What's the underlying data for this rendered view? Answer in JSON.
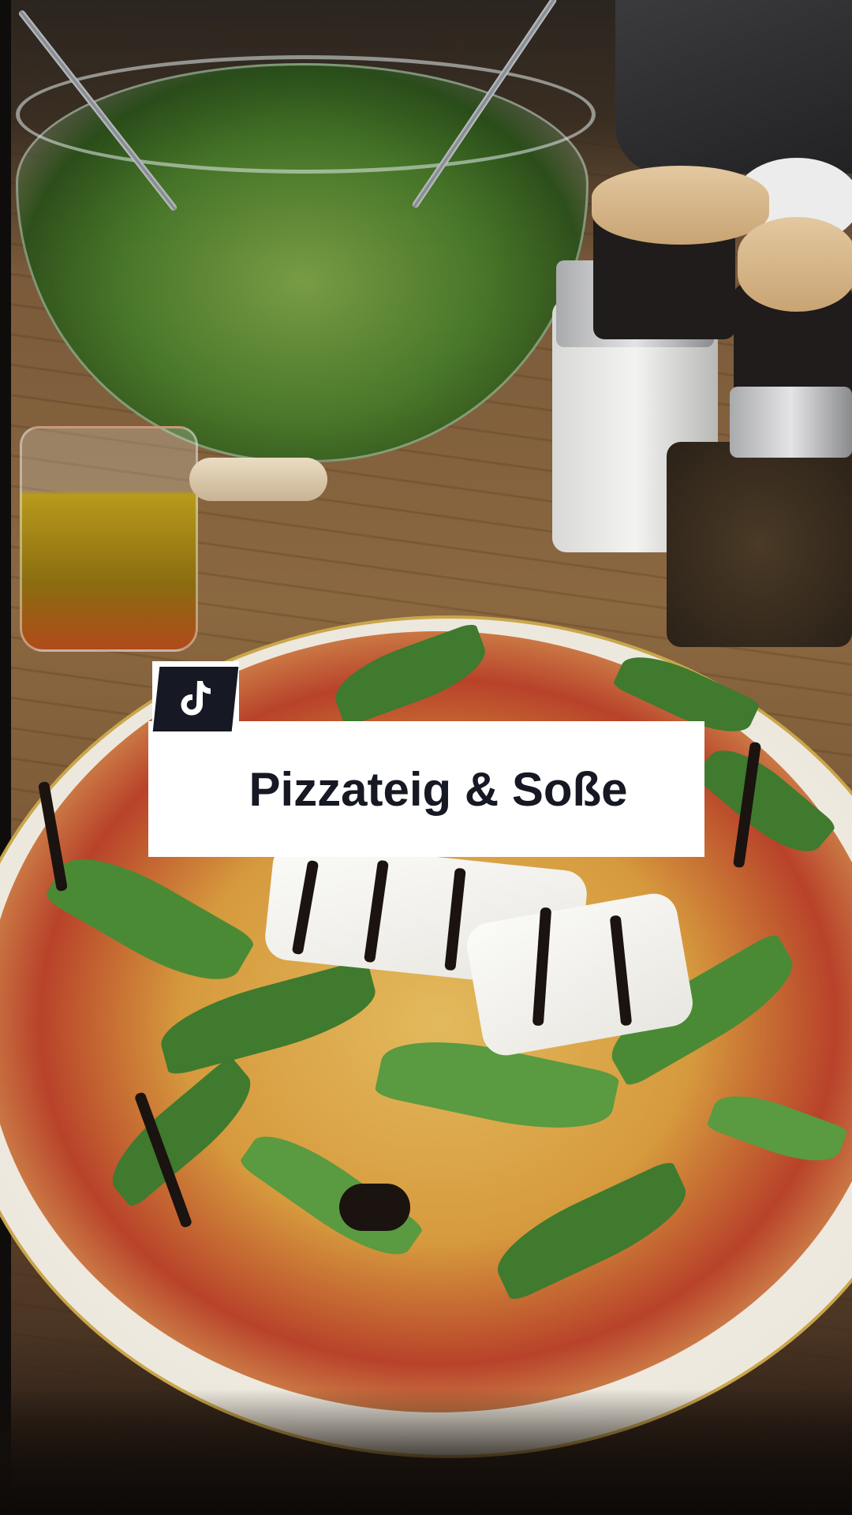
{
  "overlay": {
    "title": "Pizzateig & Soße",
    "logo_icon": "tiktok-logo-icon"
  },
  "colors": {
    "title_text": "#161823",
    "title_card_bg": "#ffffff",
    "logo_bg": "#161823"
  }
}
